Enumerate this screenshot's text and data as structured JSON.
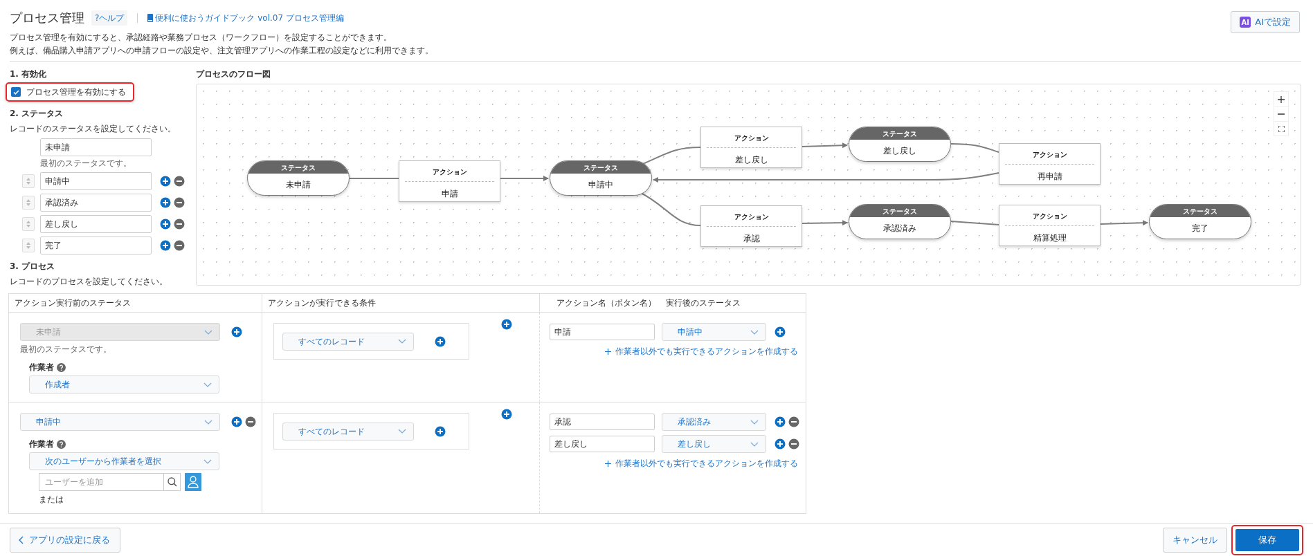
{
  "header": {
    "title": "プロセス管理",
    "help": "?ヘルプ",
    "guide_link": "便利に使おうガイドブック vol.07 プロセス管理編",
    "ai_badge": "AI",
    "ai_button": "AIで設定"
  },
  "description": [
    "プロセス管理を有効にすると、承認経路や業務プロセス（ワークフロー）を設定することができます。",
    "例えば、備品購入申請アプリへの申請フローの設定や、注文管理アプリへの作業工程の設定などに利用できます。"
  ],
  "enable": {
    "heading": "1. 有効化",
    "checkbox": {
      "label": "プロセス管理を有効にする",
      "checked": true
    }
  },
  "status": {
    "heading": "2. ステータス",
    "description": "レコードのステータスを設定してください。",
    "first": {
      "value": "未申請",
      "note": "最初のステータスです。"
    },
    "items": [
      {
        "value": "申請中"
      },
      {
        "value": "承認済み"
      },
      {
        "value": "差し戻し"
      },
      {
        "value": "完了"
      }
    ]
  },
  "process": {
    "heading": "3. プロセス",
    "description": "レコードのプロセスを設定してください。"
  },
  "flow": {
    "title": "プロセスのフロー図",
    "nodes": [
      {
        "kind": "status",
        "header": "ステータス",
        "label": "未申請"
      },
      {
        "kind": "action",
        "header": "アクション",
        "label": "申請"
      },
      {
        "kind": "status",
        "header": "ステータス",
        "label": "申請中"
      },
      {
        "kind": "action",
        "header": "アクション",
        "label": "差し戻し"
      },
      {
        "kind": "status",
        "header": "ステータス",
        "label": "差し戻し"
      },
      {
        "kind": "action",
        "header": "アクション",
        "label": "再申請"
      },
      {
        "kind": "action",
        "header": "アクション",
        "label": "承認"
      },
      {
        "kind": "status",
        "header": "ステータス",
        "label": "承認済み"
      },
      {
        "kind": "action",
        "header": "アクション",
        "label": "精算処理"
      },
      {
        "kind": "status",
        "header": "ステータス",
        "label": "完了"
      }
    ]
  },
  "table": {
    "columns": [
      "アクション実行前のステータス",
      "アクションが実行できる条件",
      "アクション名（ボタン名）",
      "実行後のステータス"
    ],
    "rows": [
      {
        "before": {
          "value": "未申請",
          "disabled": true
        },
        "removable": false,
        "note": "最初のステータスです。",
        "assignee_label": "作業者",
        "assignee": "作成者",
        "condition": "すべてのレコード",
        "actions": [
          {
            "name": "申請",
            "next": "申請中",
            "removable": false
          }
        ],
        "link": "作業者以外でも実行できるアクションを作成する"
      },
      {
        "before": {
          "value": "申請中",
          "disabled": false
        },
        "removable": true,
        "assignee_label": "作業者",
        "assignee": "次のユーザーから作業者を選択",
        "user_placeholder": "ユーザーを追加",
        "or_text": "または",
        "condition": "すべてのレコード",
        "actions": [
          {
            "name": "承認",
            "next": "承認済み",
            "removable": true
          },
          {
            "name": "差し戻し",
            "next": "差し戻し",
            "removable": true
          }
        ],
        "link": "作業者以外でも実行できるアクションを作成する"
      }
    ]
  },
  "footer": {
    "back": "アプリの設定に戻る",
    "cancel": "キャンセル",
    "save": "保存"
  }
}
